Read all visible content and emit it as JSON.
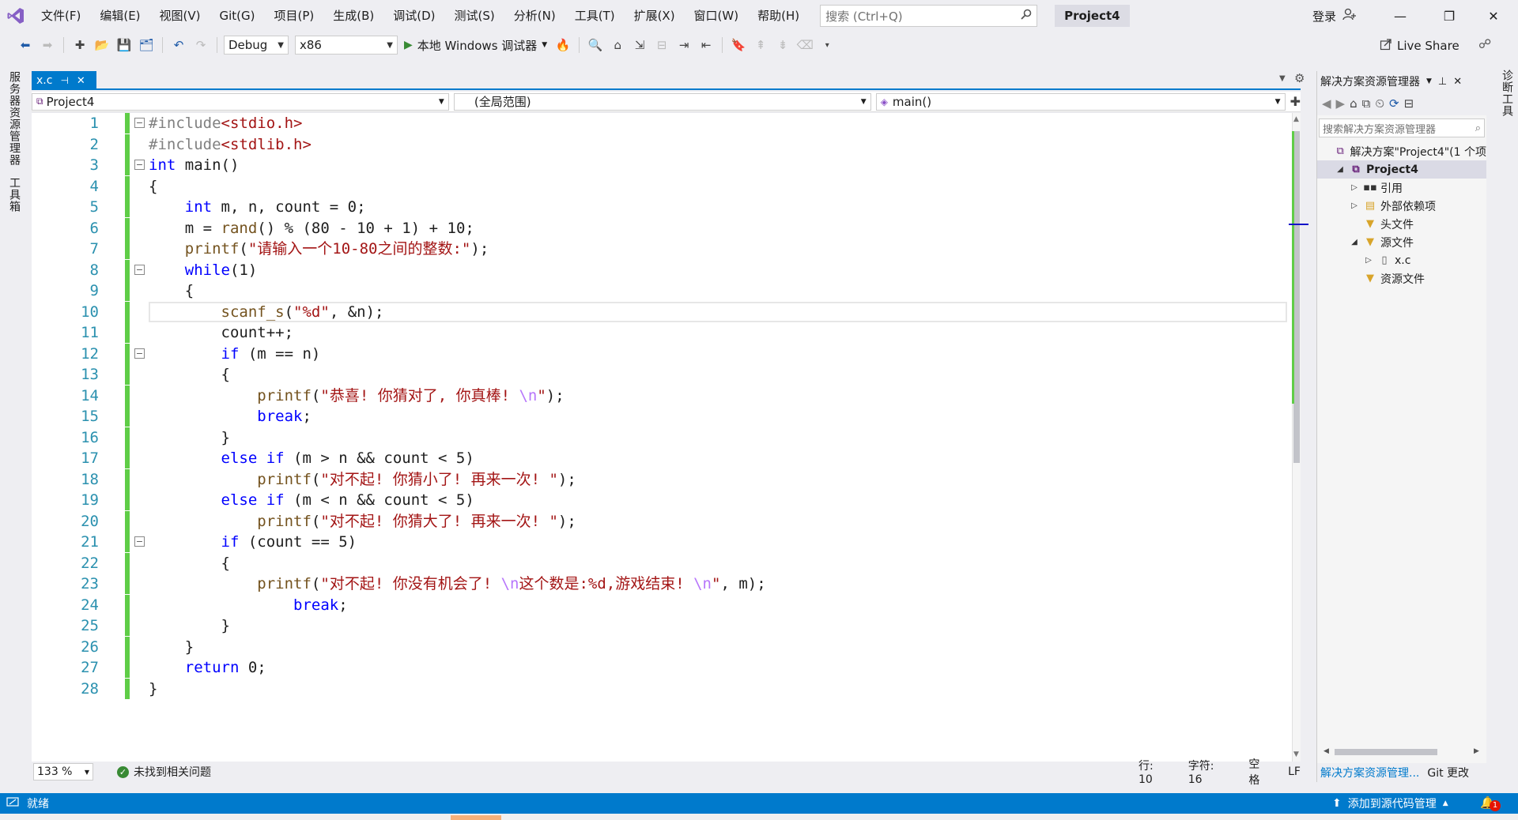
{
  "menu": {
    "items": [
      "文件(F)",
      "编辑(E)",
      "视图(V)",
      "Git(G)",
      "项目(P)",
      "生成(B)",
      "调试(D)",
      "测试(S)",
      "分析(N)",
      "工具(T)",
      "扩展(X)",
      "窗口(W)",
      "帮助(H)"
    ],
    "search_placeholder": "搜索 (Ctrl+Q)",
    "project_title": "Project4",
    "signin": "登录"
  },
  "toolbar": {
    "config": "Debug",
    "platform": "x86",
    "run_label": "本地 Windows 调试器",
    "live_share": "Live Share"
  },
  "left_rail": {
    "server_explorer": "服务器资源管理器",
    "toolbox": "工具箱"
  },
  "right_rail": {
    "diagnostics": "诊断工具"
  },
  "editor": {
    "tab_label": "x.c",
    "nav_project": "Project4",
    "nav_scope": "(全局范围)",
    "nav_member": "main()",
    "current_line": 10,
    "lines": [
      {
        "n": "1",
        "fold": "⊟",
        "tokens": [
          [
            "pp",
            "#include"
          ],
          [
            "str",
            "<stdio.h>"
          ]
        ]
      },
      {
        "n": "2",
        "fold": "",
        "tokens": [
          [
            "pp",
            "#include"
          ],
          [
            "str",
            "<stdlib.h>"
          ]
        ]
      },
      {
        "n": "3",
        "fold": "⊟",
        "tokens": [
          [
            "kw",
            "int"
          ],
          [
            "plain",
            " main()"
          ]
        ]
      },
      {
        "n": "4",
        "fold": "",
        "tokens": [
          [
            "plain",
            "{"
          ]
        ]
      },
      {
        "n": "5",
        "fold": "",
        "tokens": [
          [
            "plain",
            "    "
          ],
          [
            "kw",
            "int"
          ],
          [
            "plain",
            " m, n, count = 0;"
          ]
        ]
      },
      {
        "n": "6",
        "fold": "",
        "tokens": [
          [
            "plain",
            "    m = "
          ],
          [
            "fn",
            "rand"
          ],
          [
            "plain",
            "() % (80 - 10 + 1) + 10;"
          ]
        ]
      },
      {
        "n": "7",
        "fold": "",
        "tokens": [
          [
            "plain",
            "    "
          ],
          [
            "fn",
            "printf"
          ],
          [
            "plain",
            "("
          ],
          [
            "str",
            "\"请输入一个10-80之间的整数:\""
          ],
          [
            "plain",
            ");"
          ]
        ]
      },
      {
        "n": "8",
        "fold": "⊟",
        "tokens": [
          [
            "plain",
            "    "
          ],
          [
            "kw",
            "while"
          ],
          [
            "plain",
            "(1)"
          ]
        ]
      },
      {
        "n": "9",
        "fold": "",
        "tokens": [
          [
            "plain",
            "    {"
          ]
        ]
      },
      {
        "n": "10",
        "fold": "",
        "tokens": [
          [
            "plain",
            "        "
          ],
          [
            "fn",
            "scanf_s"
          ],
          [
            "plain",
            "("
          ],
          [
            "str",
            "\"%d\""
          ],
          [
            "plain",
            ", &n);"
          ]
        ]
      },
      {
        "n": "11",
        "fold": "",
        "tokens": [
          [
            "plain",
            "        count++;"
          ]
        ]
      },
      {
        "n": "12",
        "fold": "⊟",
        "tokens": [
          [
            "plain",
            "        "
          ],
          [
            "kw",
            "if"
          ],
          [
            "plain",
            " (m == n)"
          ]
        ]
      },
      {
        "n": "13",
        "fold": "",
        "tokens": [
          [
            "plain",
            "        {"
          ]
        ]
      },
      {
        "n": "14",
        "fold": "",
        "tokens": [
          [
            "plain",
            "            "
          ],
          [
            "fn",
            "printf"
          ],
          [
            "plain",
            "("
          ],
          [
            "str",
            "\"恭喜! 你猜对了, 你真棒! "
          ],
          [
            "esc",
            "\\n"
          ],
          [
            "str",
            "\""
          ],
          [
            "plain",
            ");"
          ]
        ]
      },
      {
        "n": "15",
        "fold": "",
        "tokens": [
          [
            "plain",
            "            "
          ],
          [
            "kw",
            "break"
          ],
          [
            "plain",
            ";"
          ]
        ]
      },
      {
        "n": "16",
        "fold": "",
        "tokens": [
          [
            "plain",
            "        }"
          ]
        ]
      },
      {
        "n": "17",
        "fold": "",
        "tokens": [
          [
            "plain",
            "        "
          ],
          [
            "kw",
            "else if"
          ],
          [
            "plain",
            " (m > n && count < 5)"
          ]
        ]
      },
      {
        "n": "18",
        "fold": "",
        "tokens": [
          [
            "plain",
            "            "
          ],
          [
            "fn",
            "printf"
          ],
          [
            "plain",
            "("
          ],
          [
            "str",
            "\"对不起! 你猜小了! 再来一次! \""
          ],
          [
            "plain",
            ");"
          ]
        ]
      },
      {
        "n": "19",
        "fold": "",
        "tokens": [
          [
            "plain",
            "        "
          ],
          [
            "kw",
            "else if"
          ],
          [
            "plain",
            " (m < n && count < 5)"
          ]
        ]
      },
      {
        "n": "20",
        "fold": "",
        "tokens": [
          [
            "plain",
            "            "
          ],
          [
            "fn",
            "printf"
          ],
          [
            "plain",
            "("
          ],
          [
            "str",
            "\"对不起! 你猜大了! 再来一次! \""
          ],
          [
            "plain",
            ");"
          ]
        ]
      },
      {
        "n": "21",
        "fold": "⊟",
        "tokens": [
          [
            "plain",
            "        "
          ],
          [
            "kw",
            "if"
          ],
          [
            "plain",
            " (count == 5)"
          ]
        ]
      },
      {
        "n": "22",
        "fold": "",
        "tokens": [
          [
            "plain",
            "        {"
          ]
        ]
      },
      {
        "n": "23",
        "fold": "",
        "tokens": [
          [
            "plain",
            "            "
          ],
          [
            "fn",
            "printf"
          ],
          [
            "plain",
            "("
          ],
          [
            "str",
            "\"对不起! 你没有机会了! "
          ],
          [
            "esc",
            "\\n"
          ],
          [
            "str",
            "这个数是:%d,游戏结束! "
          ],
          [
            "esc",
            "\\n"
          ],
          [
            "str",
            "\""
          ],
          [
            "plain",
            ", m);"
          ]
        ]
      },
      {
        "n": "24",
        "fold": "",
        "tokens": [
          [
            "plain",
            "                "
          ],
          [
            "kw",
            "break"
          ],
          [
            "plain",
            ";"
          ]
        ]
      },
      {
        "n": "25",
        "fold": "",
        "tokens": [
          [
            "plain",
            "        }"
          ]
        ]
      },
      {
        "n": "26",
        "fold": "",
        "tokens": [
          [
            "plain",
            "    }"
          ]
        ]
      },
      {
        "n": "27",
        "fold": "",
        "tokens": [
          [
            "plain",
            "    "
          ],
          [
            "kw",
            "return"
          ],
          [
            "plain",
            " 0;"
          ]
        ]
      },
      {
        "n": "28",
        "fold": "",
        "tokens": [
          [
            "plain",
            "}"
          ]
        ]
      }
    ]
  },
  "editor_status": {
    "zoom": "133 %",
    "issues": "未找到相关问题",
    "line": "行: 10",
    "col": "字符: 16",
    "whitespace": "空格",
    "eol": "LF"
  },
  "solution_explorer": {
    "title": "解决方案资源管理器",
    "search_placeholder": "搜索解决方案资源管理器",
    "tree": [
      {
        "label": "解决方案\"Project4\"(1 个项",
        "indent": 0,
        "arrow": "",
        "icon": "solution-icon",
        "selected": false
      },
      {
        "label": "Project4",
        "indent": 1,
        "arrow": "◢",
        "icon": "project-icon",
        "selected": true
      },
      {
        "label": "引用",
        "indent": 2,
        "arrow": "▷",
        "icon": "references-icon",
        "selected": false
      },
      {
        "label": "外部依赖项",
        "indent": 2,
        "arrow": "▷",
        "icon": "external-deps-icon",
        "selected": false
      },
      {
        "label": "头文件",
        "indent": 2,
        "arrow": "",
        "icon": "filter-folder-icon",
        "selected": false
      },
      {
        "label": "源文件",
        "indent": 2,
        "arrow": "◢",
        "icon": "filter-folder-icon",
        "selected": false
      },
      {
        "label": "x.c",
        "indent": 3,
        "arrow": "▷",
        "icon": "c-file-icon",
        "selected": false
      },
      {
        "label": "资源文件",
        "indent": 2,
        "arrow": "",
        "icon": "filter-folder-icon",
        "selected": false
      }
    ],
    "bottom_tab_active": "解决方案资源管理...",
    "bottom_tab_git": "Git 更改"
  },
  "statusbar": {
    "ready": "就绪",
    "source_control": "添加到源代码管理",
    "notifications": "1"
  },
  "colors": {
    "accent": "#007acc",
    "keyword": "#0000ff",
    "string": "#a31515",
    "preprocessor": "#808080",
    "function": "#74531f",
    "line_number": "#2b91af",
    "change_bar": "#5fcd47"
  }
}
